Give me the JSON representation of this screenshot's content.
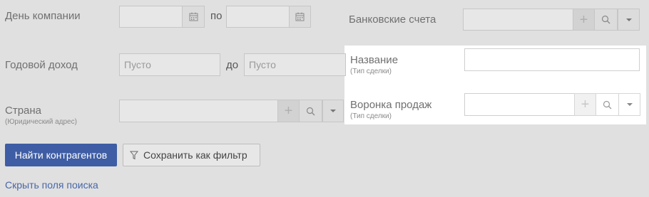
{
  "fields": {
    "company_day": {
      "label": "День компании",
      "range_word": "по",
      "from_value": "",
      "to_value": ""
    },
    "annual_income": {
      "label": "Годовой доход",
      "range_word": "до",
      "from_placeholder": "Пусто",
      "to_placeholder": "Пусто"
    },
    "country": {
      "label": "Страна",
      "sublabel": "(Юридический адрес)",
      "value": ""
    },
    "bank_accounts": {
      "label": "Банковские счета",
      "value": ""
    },
    "deal_name": {
      "label": "Название",
      "sublabel": "(Тип сделки)",
      "value": ""
    },
    "sales_funnel": {
      "label": "Воронка продаж",
      "sublabel": "(Тип сделки)",
      "value": ""
    }
  },
  "icons": {
    "calendar": "calendar-icon",
    "add": "plus-icon",
    "search": "search-icon",
    "dropdown": "chevron-down-icon",
    "filter": "funnel-icon"
  },
  "actions": {
    "find_label": "Найти контрагентов",
    "save_filter_label": "Сохранить как фильтр",
    "hide_fields_label": "Скрыть поля поиска"
  },
  "colors": {
    "background": "#e0e0e0",
    "primary_button": "#3e5da5",
    "link": "#4867a8",
    "highlight_panel": "#ffffff"
  }
}
